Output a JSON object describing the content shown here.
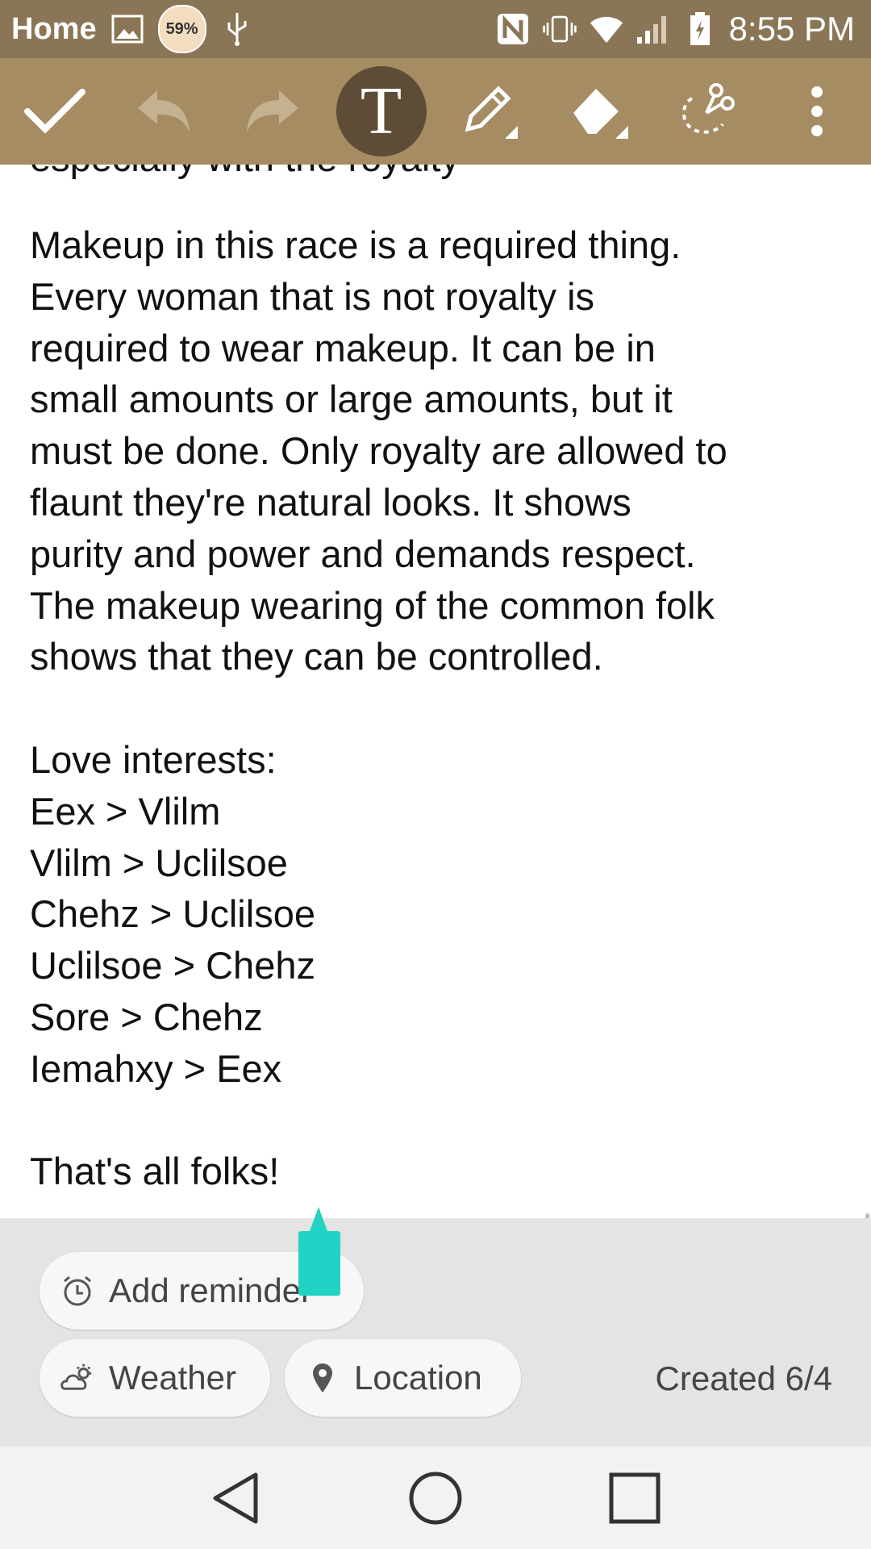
{
  "status_bar": {
    "home_label": "Home",
    "battery_avatar_text": "59%",
    "time": "8:55 PM",
    "icons": [
      "image-icon",
      "avatar-icon",
      "usb-icon",
      "nfc-icon",
      "vibrate-icon",
      "wifi-icon",
      "signal-icon",
      "battery-charging-icon"
    ]
  },
  "toolbar": {
    "buttons": [
      "check-icon",
      "undo-icon",
      "redo-icon",
      "text-tool-icon",
      "pen-icon",
      "eraser-icon",
      "lasso-cut-icon",
      "more-vert-icon"
    ],
    "text_tool_glyph": "T"
  },
  "note": {
    "partial_top_line": "especially with the royalty",
    "paragraph1": "Makeup in this race is a required thing.\nEvery woman that is not royalty is\nrequired to wear makeup. It can be in\nsmall amounts or large amounts, but it\nmust be done. Only royalty are allowed to\nflaunt they're natural looks. It shows\npurity and power and demands respect.\nThe makeup wearing of the common folk\nshows that they can be controlled.",
    "love_heading": "Love interests:",
    "love_lines": [
      "Eex > Vlilm",
      "Vlilm > Uclilsoe",
      "Chehz > Uclilsoe",
      "Uclilsoe > Chehz",
      "Sore > Chehz",
      "Iemahxy > Eex"
    ],
    "closing": "That's all folks!"
  },
  "bottom_panel": {
    "reminder_label": "Add reminder",
    "weather_label": "Weather",
    "location_label": "Location",
    "created_text": "Created 6/4"
  },
  "colors": {
    "status_bar": "#8a7656",
    "toolbar": "#a68c62",
    "active_tool": "#5e4d36",
    "cursor_handle": "#22d3c5"
  },
  "nav_bar": {
    "icons": [
      "back-icon",
      "home-icon",
      "recents-icon"
    ]
  }
}
